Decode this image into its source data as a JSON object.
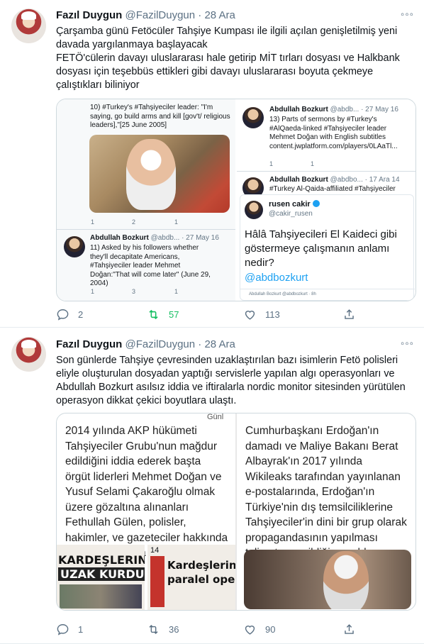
{
  "tweets": [
    {
      "author_name": "Fazıl Duygun",
      "author_handle": "@FazilDuygun",
      "separator": "·",
      "date": "28 Ara",
      "more_glyph": "◦◦◦",
      "text_line1": "Çarşamba günü Fetöcüler Tahşiye Kumpası ile ilgili açılan genişletilmiş yeni davada yargılanmaya başlayacak",
      "text_line2": "FETÖ'cülerin davayı uluslararası hale getirip MİT tırları dosyası ve Halkbank dosyası için teşebbüs ettikleri gibi davayı uluslararası boyuta çekmeye çalıştıkları biliniyor",
      "replies": "2",
      "retweets": "57",
      "likes": "113",
      "embedded": {
        "left_top_text_a": "10) #Turkey's #Tahşiyeciler leader: \"I'm saying, go build arms and kill [gov't/ religious leaders],\"[25 June 2005]",
        "left_top_replies": "1",
        "left_top_retweets": "2",
        "left_top_likes": "1",
        "left_reply_name": "Abdullah Bozkurt",
        "left_reply_meta": "@abdb... · 27 May 16",
        "left_reply_text": "11) Asked by his followers whether they'll decapitate Americans, #Tahşiyeciler leader Mehmet Doğan:\"That will come later\" (June 29, 2004)",
        "left_reply_replies": "1",
        "left_reply_retweets": "3",
        "left_reply_likes": "1",
        "right_name": "Abdullah Bozkurt",
        "right_meta": "@abdb... · 27 May 16",
        "right_text": "13) Parts of sermons by #Turkey's #AlQaeda-linked #Tahşiyeciler leader Mehmet Doğan with English subtitles content.jwplatform.com/players/0LAaTl...",
        "right_replies": "1",
        "right_retweets": "1",
        "right_likes": "",
        "right2_name": "Abdullah Bozkurt",
        "right2_meta": "@abdbo... · 17 Ara 14",
        "right2_text": "#Turkey Al-Qaida-affiliated #Tahşiyeciler",
        "quote_name": "rusen cakir",
        "quote_handle": "@cakir_rusen",
        "quote_text": "Hâlâ Tahşiyecileri El Kaideci gibi göstermeye çalışmanın anlamı nedir?",
        "quote_mention": "@abdbozkurt",
        "quote_footer": "Abdullah Bozkurt @abdbozkurt · 8h"
      }
    },
    {
      "author_name": "Fazıl Duygun",
      "author_handle": "@FazilDuygun",
      "separator": "·",
      "date": "28 Ara",
      "more_glyph": "◦◦◦",
      "text": "Son günlerde Tahşiye çevresinden uzaklaştırılan bazı isimlerin Fetö polisleri eliyle oluşturulan dosyadan yaptığı servislerle yapılan algı operasyonları ve Abdullah Bozkurt asılsız iddia ve iftiralarla nordic monitor sitesinden yürütülen operasyon dikkat çekici boyutlara ulaştı.",
      "replies": "1",
      "retweets": "36",
      "likes": "90",
      "embedded": {
        "left_text": "2014 yılında AKP hükümeti Tahşiyeciler Grubu'nun mağdur edildiğini iddia ederek başta örgüt liderleri Mehmet Doğan ve Yusuf Selami Çakaroğlu olmak üzere gözaltına alınanları Fethullah Gülen, polisler, hakimler, ve gazeteciler hakkında şikayetçi olmaya çağırdı.",
        "right_text": "Cumhurbaşkanı Erdoğan'ın damadı ve Maliye Bakanı Berat Albayrak'ın 2017 yılında Wikileaks tarafından yayınlanan e-postalarında, Erdoğan'ın Türkiye'nin dış temsilciliklerine Tahşiyeciler'in dini bir grup olarak propagandasının yapılması talimatını verildiği yer aldı.",
        "paper1_headline_a": "KARDEŞLERINE BI",
        "paper1_headline_b": "UZAK KURDULAR",
        "paper2_page": "14",
        "paper2_headline_a": "Kardeşlerine",
        "paper2_headline_b": "paralel opera",
        "paper2_corner": "Günl"
      }
    }
  ]
}
